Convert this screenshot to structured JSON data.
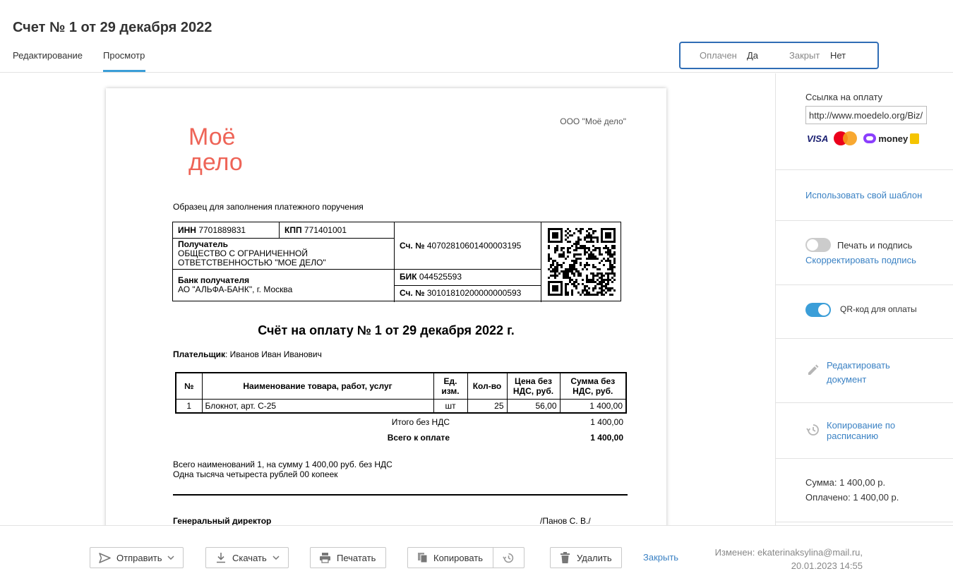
{
  "header": {
    "title": "Счет № 1 от 29 декабря 2022",
    "tabs": [
      "Редактирование",
      "Просмотр"
    ],
    "status": {
      "paid_label": "Оплачен",
      "paid_value": "Да",
      "closed_label": "Закрыт",
      "closed_value": "Нет"
    }
  },
  "document": {
    "company": "ООО \"Моё дело\"",
    "logo_lines": [
      "Моё",
      "дело"
    ],
    "logo_color": "#ee6457",
    "sample_title": "Образец для заполнения платежного поручения",
    "bank": {
      "inn_label": "ИНН",
      "inn": "7701889831",
      "kpp_label": "КПП",
      "kpp": "771401001",
      "recipient_label": "Получатель",
      "recipient": "ОБЩЕСТВО С ОГРАНИЧЕННОЙ ОТВЕТСТВЕННОСТЬЮ \"МОЕ ДЕЛО\"",
      "account_label": "Сч. №",
      "account": "40702810601400003195",
      "bank_label": "Банк получателя",
      "bank": "АО \"АЛЬФА-БАНК\", г. Москва",
      "bik_label": "БИК",
      "bik": "044525593",
      "corr_label": "Сч. №",
      "corr": "30101810200000000593"
    },
    "invoice_title": "Счёт на оплату № 1 от 29 декабря 2022 г.",
    "payer_label": "Плательщик",
    "payer": ": Иванов Иван Иванович",
    "table": {
      "headers": [
        "№",
        "Наименование товара, работ, услуг",
        "Ед. изм.",
        "Кол-во",
        "Цена без НДС, руб.",
        "Сумма без НДС, руб."
      ],
      "rows": [
        [
          "1",
          "Блокнот, арт. С-25",
          "шт",
          "25",
          "56,00",
          "1 400,00"
        ]
      ]
    },
    "total_no_vat_label": "Итого без НДС",
    "total_no_vat": "1 400,00",
    "total_label": "Всего к оплате",
    "total": "1 400,00",
    "summary_line1": "Всего наименований 1, на сумму 1 400,00 руб. без НДС",
    "summary_line2": "Одна тысяча четыреста рублей 00 копеек",
    "director_label": "Генеральный директор",
    "director_name": "/Панов С. В./"
  },
  "sidebar": {
    "payment_link_label": "Ссылка на оплату",
    "payment_link_value": "http://www.moedelo.org/Biz/",
    "payment_methods": [
      "VISA",
      "MasterCard",
      "money"
    ],
    "own_template_link": "Использовать свой шаблон",
    "stamp_label": "Печать и подпись",
    "stamp_enabled": false,
    "fix_signature_link": "Скорректировать подпись",
    "qr_label": "QR-код для оплаты",
    "qr_enabled": true,
    "edit_doc_link": "Редактировать документ",
    "schedule_copy_link": "Копирование по расписанию",
    "sum_text": "Сумма: 1 400,00 р.",
    "paid_text": "Оплачено: 1 400,00 р."
  },
  "footer": {
    "send": "Отправить",
    "download": "Скачать",
    "print": "Печатать",
    "copy": "Копировать",
    "delete": "Удалить",
    "close": "Закрыть",
    "modified_line1": "Изменен: ekaterinaksylina@mail.ru,",
    "modified_line2": "20.01.2023 14:55"
  }
}
